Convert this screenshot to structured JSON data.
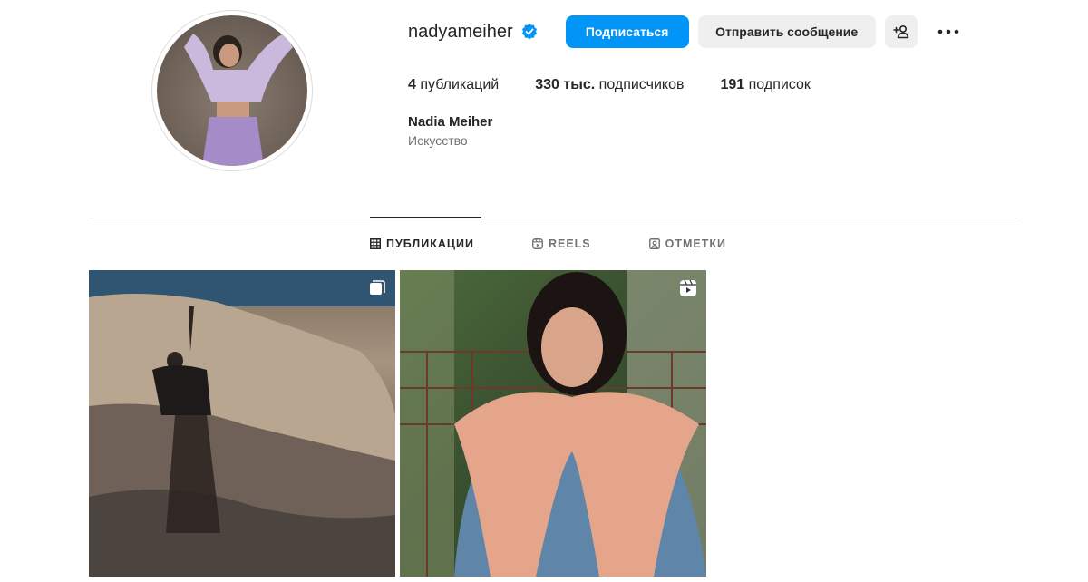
{
  "profile": {
    "username": "nadyameiher",
    "full_name": "Nadia Meiher",
    "category": "Искусство",
    "verified": true
  },
  "actions": {
    "follow_label": "Подписаться",
    "message_label": "Отправить сообщение",
    "add_person_icon": "person-add-icon",
    "more_icon": "more-icon"
  },
  "stats": {
    "posts_count": "4",
    "posts_label": "публикаций",
    "followers_count": "330 тыс.",
    "followers_label": "подписчиков",
    "following_count": "191",
    "following_label": "подписок"
  },
  "tabs": [
    {
      "label": "ПУБЛИКАЦИИ",
      "icon": "grid-icon",
      "active": true
    },
    {
      "label": "REELS",
      "icon": "reels-icon",
      "active": false
    },
    {
      "label": "ОТМЕТКИ",
      "icon": "tagged-icon",
      "active": false
    }
  ],
  "posts": [
    {
      "type": "carousel",
      "badge_icon": "carousel-icon"
    },
    {
      "type": "reel",
      "badge_icon": "reels-icon"
    }
  ],
  "colors": {
    "accent": "#0095f6",
    "verified": "#0095f6",
    "button_secondary": "#efefef"
  }
}
